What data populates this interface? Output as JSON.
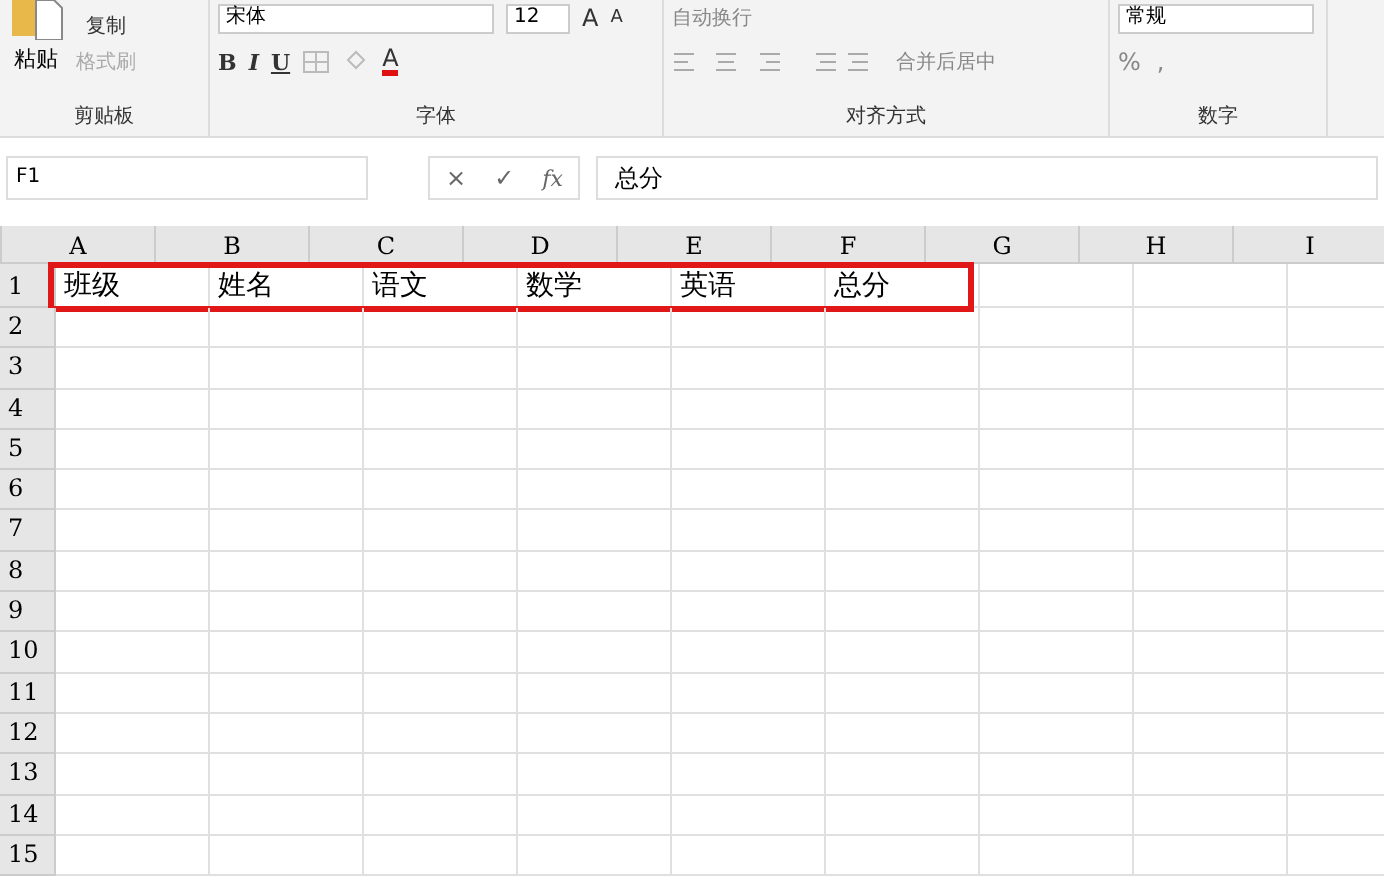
{
  "ribbon": {
    "groups": [
      {
        "kind": "clipboard",
        "label": "剪贴板",
        "paste": "粘贴",
        "items": [
          {
            "label": "复制",
            "disabled": false
          },
          {
            "label": "格式刷",
            "disabled": true
          }
        ]
      },
      {
        "kind": "font",
        "label": "字体",
        "font_name": "宋体",
        "font_size": "12",
        "grow": "A",
        "shrink": "A",
        "styles": [
          "B",
          "I",
          "U"
        ],
        "font_color": "A"
      },
      {
        "kind": "align",
        "label": "对齐方式",
        "items": [
          {
            "label": "自动换行"
          },
          {
            "label": "合并后居中"
          }
        ]
      },
      {
        "kind": "number",
        "label": "数字",
        "format": "常规",
        "symbols": [
          "%",
          ","
        ]
      }
    ]
  },
  "formula_bar": {
    "name_box": "F1",
    "buttons": [
      "×",
      "✓",
      "fx"
    ],
    "value": "总分"
  },
  "sheet": {
    "columns": [
      "A",
      "B",
      "C",
      "D",
      "E",
      "F",
      "G",
      "H",
      "I"
    ],
    "rows": [
      {
        "header": "1",
        "cells": [
          "班级",
          "姓名",
          "语文",
          "数学",
          "英语",
          "总分"
        ],
        "highlighted": true
      },
      {
        "header": "2"
      },
      {
        "header": "3"
      },
      {
        "header": "4"
      },
      {
        "header": "5"
      },
      {
        "header": "6"
      },
      {
        "header": "7"
      },
      {
        "header": "8"
      },
      {
        "header": "9"
      },
      {
        "header": "10"
      },
      {
        "header": "11"
      },
      {
        "header": "12"
      },
      {
        "header": "13"
      },
      {
        "header": "14"
      },
      {
        "header": "15"
      }
    ]
  }
}
